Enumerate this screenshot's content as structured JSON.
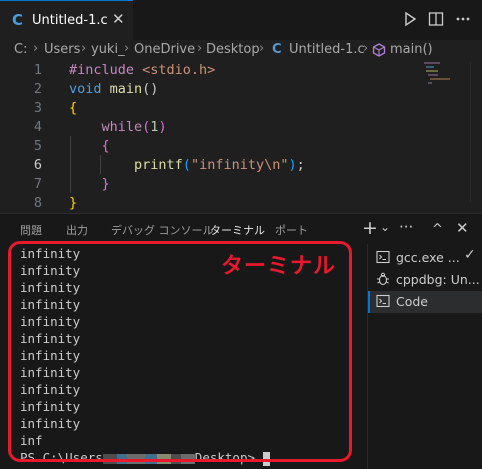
{
  "tab": {
    "icon": "C",
    "label": "Untitled-1.c",
    "close": "✕"
  },
  "actions": {
    "run_label": "run-icon",
    "split_label": "split-editor-icon",
    "more_label": "more-icon"
  },
  "breadcrumb": {
    "items": [
      "C:",
      "Users",
      "yuki_",
      "OneDrive",
      "Desktop",
      "Untitled-1.c",
      "main()"
    ],
    "c_icon": "C"
  },
  "editor": {
    "line_numbers": [
      "1",
      "2",
      "3",
      "4",
      "5",
      "6",
      "7",
      "8"
    ],
    "active_line": 6,
    "lines": [
      {
        "parts": [
          {
            "t": "#include ",
            "c": "kw-pp"
          },
          {
            "t": "<stdio.h>",
            "c": "str"
          }
        ]
      },
      {
        "parts": [
          {
            "t": "void ",
            "c": "kw"
          },
          {
            "t": "main",
            "c": "fn"
          },
          {
            "t": "()",
            "c": "plain"
          }
        ]
      },
      {
        "parts": [
          {
            "t": "{",
            "c": "brace1"
          }
        ]
      },
      {
        "parts": [
          {
            "t": "    while",
            "c": "kw-pp"
          },
          {
            "t": "(",
            "c": "brace2"
          },
          {
            "t": "1",
            "c": "num"
          },
          {
            "t": ")",
            "c": "brace2"
          }
        ]
      },
      {
        "parts": [
          {
            "t": "    {",
            "c": "brace2"
          }
        ]
      },
      {
        "parts": [
          {
            "t": "        printf",
            "c": "fn"
          },
          {
            "t": "(",
            "c": "brace3"
          },
          {
            "t": "\"infinity\\n\"",
            "c": "str"
          },
          {
            "t": ")",
            "c": "brace3"
          },
          {
            "t": ";",
            "c": "plain"
          }
        ]
      },
      {
        "parts": [
          {
            "t": "    }",
            "c": "brace2"
          }
        ]
      },
      {
        "parts": [
          {
            "t": "}",
            "c": "brace1"
          }
        ]
      }
    ]
  },
  "panel": {
    "tabs": [
      "問題",
      "出力",
      "デバッグ コンソール",
      "ターミナル",
      "ポート"
    ],
    "active_tab": "ターミナル",
    "icons": {
      "add": "+",
      "dropdown": "⌄",
      "more": "···",
      "maximize": "^",
      "close": "✕"
    }
  },
  "terminal": {
    "lines": [
      "infinity",
      "infinity",
      "infinity",
      "infinity",
      "infinity",
      "infinity",
      "infinity",
      "infinity",
      "infinity",
      "infinity",
      "infinity",
      "inf"
    ],
    "prompt_prefix": "PS C:\\Users",
    "prompt_suffix": "Desktop>",
    "annotation": "ターミナル"
  },
  "terminal_list": [
    {
      "icon": "terminal-icon",
      "label": "gcc.exe ...",
      "check": "✓"
    },
    {
      "icon": "debug-icon",
      "label": "cppdbg: Un..."
    },
    {
      "icon": "terminal-icon",
      "label": "Code",
      "active": true
    }
  ],
  "colors": {
    "accent": "#0078d4",
    "annotation": "#e8192c"
  }
}
